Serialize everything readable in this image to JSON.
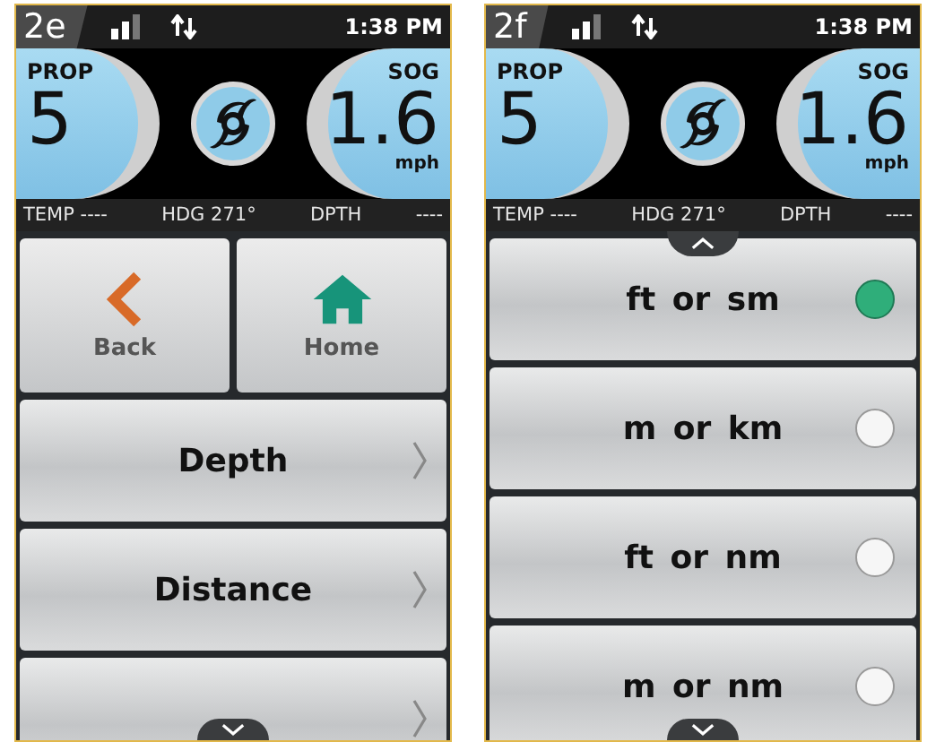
{
  "screens": [
    {
      "badge": "2e",
      "time": "1:38 PM",
      "gauges": [
        {
          "label": "PROP",
          "value": "5"
        },
        {
          "label": "SOG",
          "value": "1.6",
          "unit": "mph"
        }
      ],
      "info": [
        "TEMP ----",
        "HDG 271°",
        "DPTH",
        "----"
      ],
      "scroll_up": false,
      "scroll_down": true,
      "nav_buttons": [
        {
          "label": "Back",
          "kind": "back"
        },
        {
          "label": "Home",
          "kind": "home"
        }
      ],
      "rows": [
        {
          "kind": "submenu",
          "label": "Depth"
        },
        {
          "kind": "submenu",
          "label": "Distance"
        },
        {
          "kind": "submenu"
        }
      ]
    },
    {
      "badge": "2f",
      "time": "1:38 PM",
      "gauges": [
        {
          "label": "PROP",
          "value": "5"
        },
        {
          "label": "SOG",
          "value": "1.6",
          "unit": "mph"
        }
      ],
      "info": [
        "TEMP ----",
        "HDG 271°",
        "DPTH",
        "----"
      ],
      "scroll_up": true,
      "scroll_down": true,
      "rows": [
        {
          "kind": "radio",
          "label": "ft or sm",
          "selected": true
        },
        {
          "kind": "radio",
          "label": "m or km",
          "selected": false
        },
        {
          "kind": "radio",
          "label": "ft or nm",
          "selected": false
        },
        {
          "kind": "radio",
          "label": "m or nm",
          "selected": false
        }
      ]
    }
  ]
}
